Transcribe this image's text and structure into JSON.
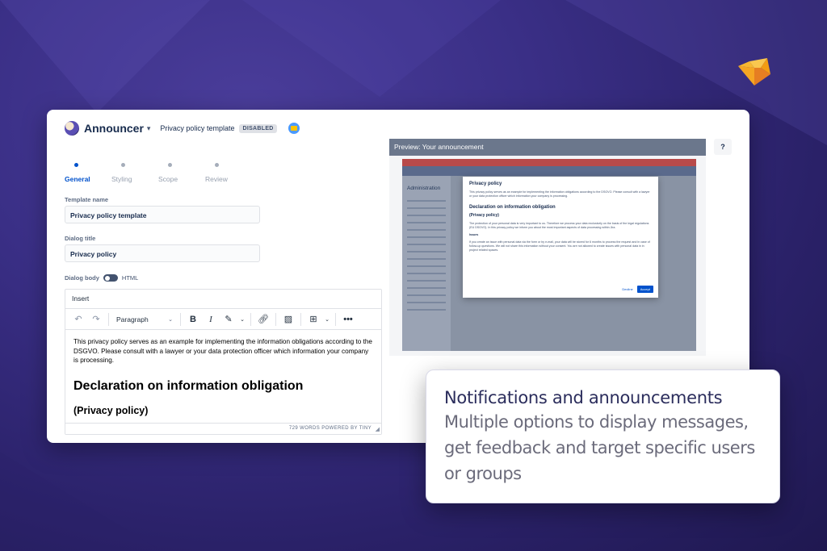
{
  "brand": {
    "logo_icon": "fox-logo-icon",
    "accent": "#0052cc",
    "background": "#3a2f86"
  },
  "app": {
    "name": "Announcer",
    "template_title": "Privacy policy template",
    "status_badge": "DISABLED"
  },
  "steps": [
    {
      "label": "General",
      "active": true
    },
    {
      "label": "Styling",
      "active": false
    },
    {
      "label": "Scope",
      "active": false
    },
    {
      "label": "Review",
      "active": false
    }
  ],
  "form": {
    "template_name_label": "Template name",
    "template_name_value": "Privacy policy template",
    "dialog_title_label": "Dialog title",
    "dialog_title_value": "Privacy policy",
    "dialog_body_label": "Dialog body",
    "html_label": "HTML"
  },
  "editor": {
    "menu_insert": "Insert",
    "format_select": "Paragraph",
    "body_text": "This privacy policy serves as an example for implementing the information obligations according to the DSGVO. Please consult with a lawyer or your data protection officer which information your company is processing.",
    "heading1": "Declaration on information obligation",
    "heading2": "(Privacy policy)",
    "status": "729 WORDS  POWERED BY TINY"
  },
  "preview": {
    "title": "Preview: Your announcement",
    "help_label": "?",
    "sidebar_title": "Administration",
    "modal_title": "Privacy policy",
    "modal_body": "This privacy policy serves as an example for implementing the information obligations according to the DSGVO. Please consult with a lawyer or your data protection officer which information your company is processing.",
    "modal_heading": "Declaration on information obligation",
    "modal_subheading": "(Privacy policy)",
    "modal_para2": "The protection of your personal data is very important to us. Therefore we process your data exclusively on the basis of the legal regulations (EU DSGVO). In this privacy policy we inform you about the most important aspects of data processing within Jira.",
    "modal_issues": "Issues",
    "modal_para3": "If you create an issue with personal data via the form or by e-mail, your data will be stored for 6 months to process the request and in case of follow-up questions. We will not share this information without your consent. You are not allowed to create issues with personal data in in project related spaces.",
    "decline": "Decline",
    "accept": "Accept"
  },
  "callout": {
    "title": "Notifications and announcements",
    "body": "Multiple options to display messages, get feedback and target specific users or groups"
  }
}
